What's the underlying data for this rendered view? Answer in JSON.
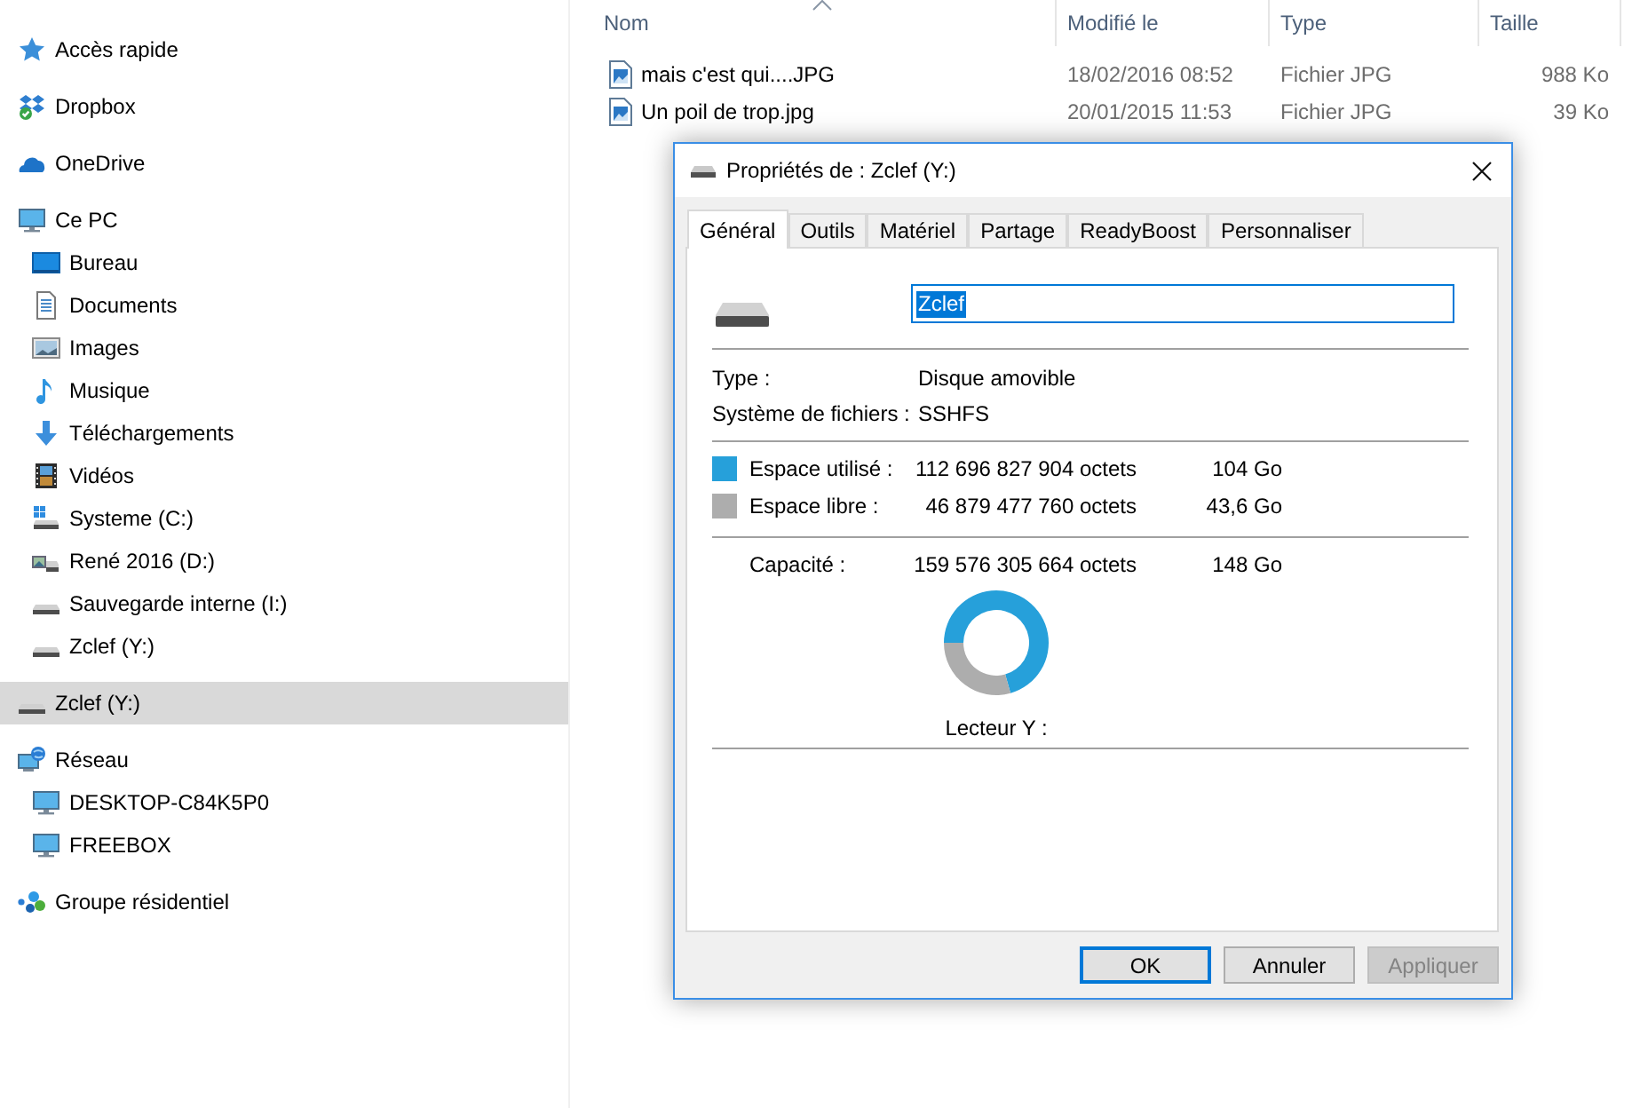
{
  "navigation_pane": {
    "items": [
      {
        "label": "Accès rapide",
        "kind": "quick_access",
        "selected": false
      },
      {
        "label": "Dropbox",
        "kind": "sync_folder",
        "selected": false
      },
      {
        "label": "OneDrive",
        "kind": "cloud",
        "selected": false
      },
      {
        "label": "Ce PC",
        "kind": "computer",
        "selected": false,
        "children": [
          {
            "label": "Bureau",
            "kind": "desktop",
            "selected": false
          },
          {
            "label": "Documents",
            "kind": "documents",
            "selected": false
          },
          {
            "label": "Images",
            "kind": "pictures",
            "selected": false
          },
          {
            "label": "Musique",
            "kind": "music",
            "selected": false
          },
          {
            "label": "Téléchargements",
            "kind": "downloads",
            "selected": false
          },
          {
            "label": "Vidéos",
            "kind": "videos",
            "selected": false
          },
          {
            "label": "Systeme (C:)",
            "kind": "system_drive",
            "selected": false
          },
          {
            "label": "René 2016 (D:)",
            "kind": "picture_drive",
            "selected": false
          },
          {
            "label": "Sauvegarde interne (I:)",
            "kind": "drive",
            "selected": false
          },
          {
            "label": "Zclef (Y:)",
            "kind": "drive",
            "selected": false
          }
        ]
      },
      {
        "label": "Zclef (Y:)",
        "kind": "drive",
        "selected": true
      },
      {
        "label": "Réseau",
        "kind": "network",
        "selected": false,
        "children": [
          {
            "label": "DESKTOP-C84K5P0",
            "kind": "network_computer",
            "selected": false
          },
          {
            "label": "FREEBOX",
            "kind": "network_computer",
            "selected": false
          }
        ]
      },
      {
        "label": "Groupe résidentiel",
        "kind": "homegroup",
        "selected": false
      }
    ]
  },
  "file_list": {
    "columns": [
      {
        "label": "Nom",
        "sorted": true
      },
      {
        "label": "Modifié le",
        "sorted": false
      },
      {
        "label": "Type",
        "sorted": false
      },
      {
        "label": "Taille",
        "sorted": false
      }
    ],
    "rows": [
      {
        "name": "mais c'est qui....JPG",
        "modified": "18/02/2016 08:52",
        "type": "Fichier JPG",
        "size": "988 Ko"
      },
      {
        "name": "Un poil de trop.jpg",
        "modified": "20/01/2015 11:53",
        "type": "Fichier JPG",
        "size": "39 Ko"
      }
    ]
  },
  "dialog": {
    "title": "Propriétés de : Zclef (Y:)",
    "tabs": [
      {
        "label": "Général",
        "selected": true
      },
      {
        "label": "Outils",
        "selected": false
      },
      {
        "label": "Matériel",
        "selected": false
      },
      {
        "label": "Partage",
        "selected": false
      },
      {
        "label": "ReadyBoost",
        "selected": false
      },
      {
        "label": "Personnaliser",
        "selected": false
      }
    ],
    "drive_name": {
      "value": "Zclef",
      "highlighted": true
    },
    "properties": [
      {
        "label": "Type :",
        "value": "Disque amovible"
      },
      {
        "label": "Système de fichiers :",
        "value": "SSHFS"
      }
    ],
    "space": [
      {
        "label": "Espace utilisé :",
        "bytes": "112 696 827 904 octets",
        "size": "104 Go",
        "color": "#26a0da"
      },
      {
        "label": "Espace libre :",
        "bytes": "46 879 477 760 octets",
        "size": "43,6 Go",
        "color": "#adadad"
      }
    ],
    "capacity": {
      "label": "Capacité :",
      "bytes": "159 576 305 664 octets",
      "size": "148 Go"
    },
    "chart_data": {
      "type": "donut",
      "values": [
        70.6,
        29.4
      ]
    },
    "drive_caption": "Lecteur Y :",
    "buttons": [
      {
        "label": "OK",
        "default": true,
        "disabled": false
      },
      {
        "label": "Annuler",
        "default": false,
        "disabled": false
      },
      {
        "label": "Appliquer",
        "default": false,
        "disabled": true
      }
    ]
  }
}
